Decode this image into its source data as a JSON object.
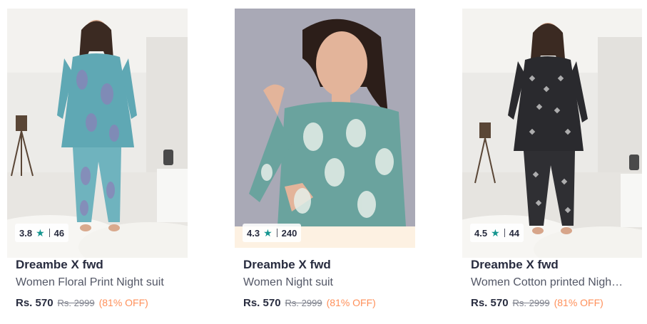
{
  "products": [
    {
      "brand": "Dreambe X fwd",
      "title": "Women Floral Print Night suit",
      "price": "Rs. 570",
      "mrp": "Rs. 2999",
      "discount": "(81% OFF)",
      "rating": "3.8",
      "rating_count": "46",
      "outfit_color": "#5fa8b4"
    },
    {
      "brand": "Dreambe X fwd",
      "title": "Women Night suit",
      "price": "Rs. 570",
      "mrp": "Rs. 2999",
      "discount": "(81% OFF)",
      "rating": "4.3",
      "rating_count": "240",
      "outfit_color": "#6aa39e"
    },
    {
      "brand": "Dreambe X fwd",
      "title": "Women Cotton printed Nigh…",
      "price": "Rs. 570",
      "mrp": "Rs. 2999",
      "discount": "(81% OFF)",
      "rating": "4.5",
      "rating_count": "44",
      "outfit_color": "#2a2a2e"
    }
  ],
  "colors": {
    "star": "#14958f",
    "discount": "#ff905a",
    "text_primary": "#282c3f",
    "text_secondary": "#535766"
  }
}
